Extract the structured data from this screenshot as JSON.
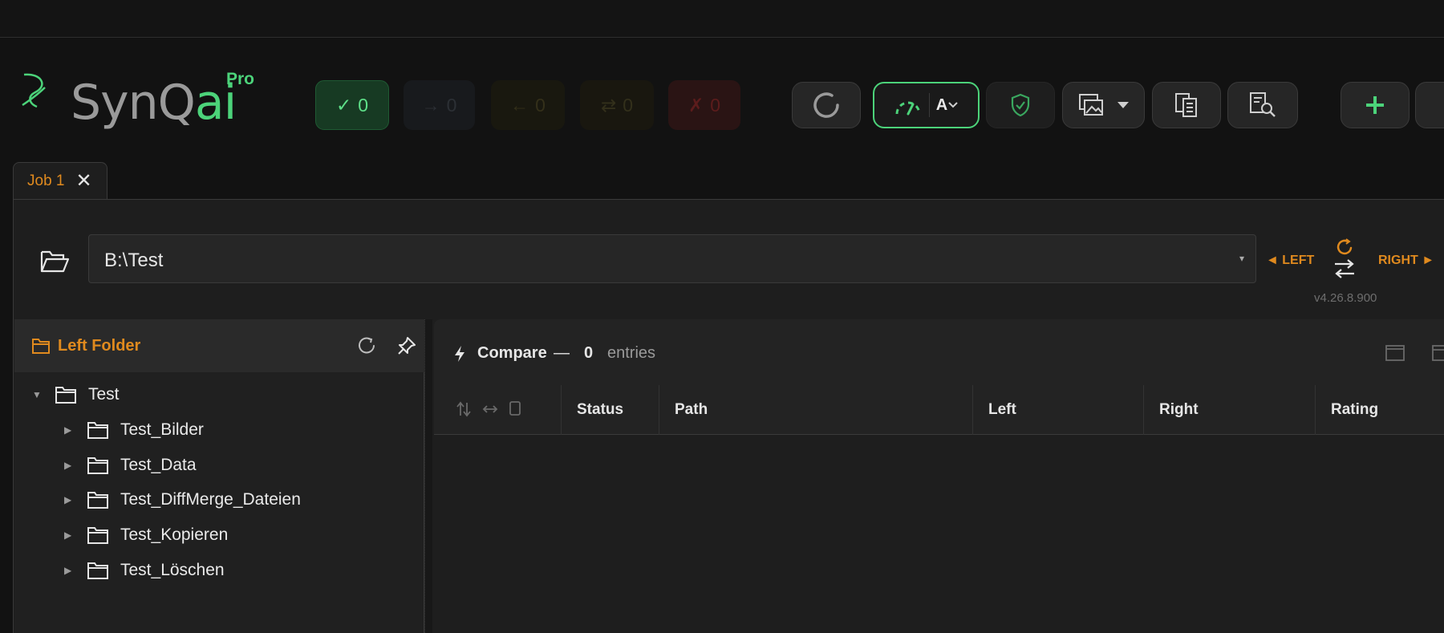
{
  "app": {
    "logo_main": "SynQ",
    "logo_ai": "ai",
    "logo_edition": "Pro",
    "accent": "#4cd37a",
    "warn_color": "#e08a1e"
  },
  "counters": {
    "same": {
      "symbol": "✓",
      "value": "0"
    },
    "right": {
      "symbol": "→",
      "value": "0"
    },
    "left": {
      "symbol": "←",
      "value": "0"
    },
    "diff": {
      "symbol": "⇄",
      "value": "0"
    },
    "error": {
      "symbol": "✗",
      "value": "0"
    }
  },
  "toolbar": {
    "auto_letter": "A"
  },
  "tabs": [
    {
      "label": "Job 1",
      "close": "✕"
    }
  ],
  "path_bar": {
    "value": "B:\\Test",
    "caret": "▾",
    "left_label": "◄ LEFT",
    "right_label": "RIGHT ►",
    "version": "v4.26.8.900"
  },
  "left_panel": {
    "title": "Left Folder",
    "tree": [
      {
        "name": "Test",
        "arrow": "▼"
      },
      {
        "name": "Test_Bilder",
        "arrow": "▶"
      },
      {
        "name": "Test_Data",
        "arrow": "▶"
      },
      {
        "name": "Test_DiffMerge_Dateien",
        "arrow": "▶"
      },
      {
        "name": "Test_Kopieren",
        "arrow": "▶"
      },
      {
        "name": "Test_Löschen",
        "arrow": "▶"
      }
    ]
  },
  "compare_panel": {
    "title": "Compare",
    "dash": "—",
    "count": "0",
    "entries_label": "entries",
    "columns": [
      "Status",
      "Path",
      "Left",
      "Right",
      "Rating"
    ]
  }
}
